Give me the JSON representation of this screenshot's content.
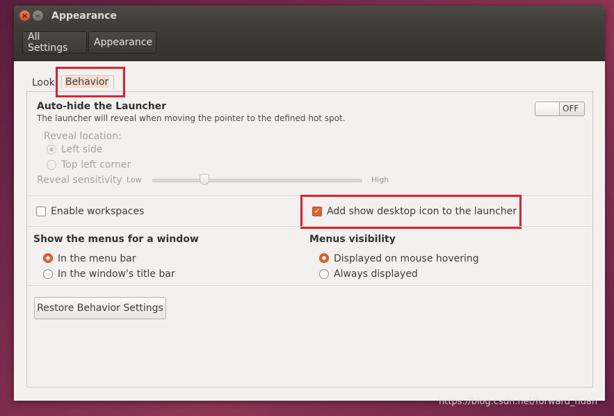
{
  "window": {
    "title": "Appearance"
  },
  "toolbar": {
    "crumb_all": "All Settings",
    "crumb_current": "Appearance"
  },
  "tabs": {
    "look": "Look",
    "behavior": "Behavior"
  },
  "autohide": {
    "title": "Auto-hide the Launcher",
    "description": "The launcher will reveal when moving the pointer to the defined hot spot.",
    "switch_state": "OFF",
    "reveal_location_label": "Reveal location:",
    "left_side": "Left side",
    "top_left_corner": "Top left corner",
    "sensitivity_label": "Reveal sensitivity",
    "low": "Low",
    "high": "High",
    "sensitivity_value": 0.25
  },
  "workspaces": {
    "label": "Enable workspaces",
    "checked": false
  },
  "desktop_icon": {
    "label": "Add show desktop icon to the launcher",
    "checked": true
  },
  "menus": {
    "heading": "Show the menus for a window",
    "in_menu_bar": "In the menu bar",
    "in_title_bar": "In the window's title bar"
  },
  "visibility": {
    "heading": "Menus visibility",
    "on_hover": "Displayed on mouse hovering",
    "always": "Always displayed"
  },
  "restore_button": "Restore Behavior Settings",
  "watermark": "https://blog.csdn.net/forward_huan",
  "colors": {
    "accent": "#e0602a",
    "highlight_box": "#e0202a",
    "titlebar": "#3d3c38"
  }
}
